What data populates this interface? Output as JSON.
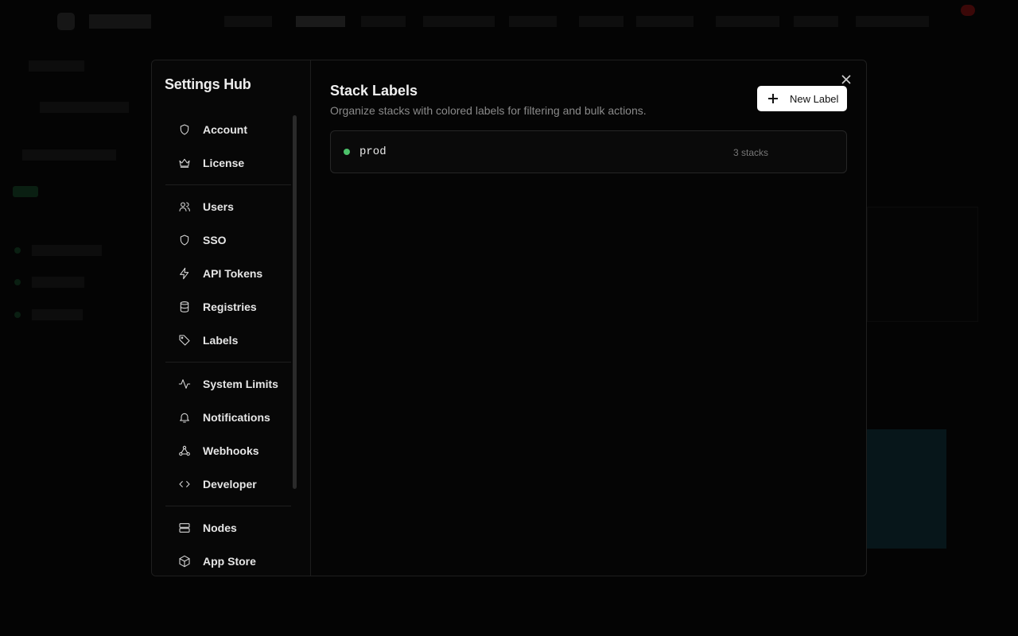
{
  "modal": {
    "sidebar": {
      "title": "Settings Hub",
      "groups": [
        [
          {
            "label": "Account",
            "icon": "shield-icon"
          },
          {
            "label": "License",
            "icon": "crown-icon"
          }
        ],
        [
          {
            "label": "Users",
            "icon": "users-icon"
          },
          {
            "label": "SSO",
            "icon": "shield-icon"
          },
          {
            "label": "API Tokens",
            "icon": "lightning-icon"
          },
          {
            "label": "Registries",
            "icon": "database-icon"
          },
          {
            "label": "Labels",
            "icon": "tag-icon"
          }
        ],
        [
          {
            "label": "System Limits",
            "icon": "activity-icon"
          },
          {
            "label": "Notifications",
            "icon": "bell-icon"
          },
          {
            "label": "Webhooks",
            "icon": "webhook-icon"
          },
          {
            "label": "Developer",
            "icon": "code-icon"
          }
        ],
        [
          {
            "label": "Nodes",
            "icon": "server-icon"
          },
          {
            "label": "App Store",
            "icon": "package-icon"
          }
        ]
      ]
    },
    "main": {
      "title": "Stack Labels",
      "subtitle": "Organize stacks with colored labels for filtering and bulk actions.",
      "new_button_label": "New Label",
      "labels": [
        {
          "name": "prod",
          "count_text": "3 stacks",
          "color": "#4cc26a"
        }
      ]
    }
  }
}
